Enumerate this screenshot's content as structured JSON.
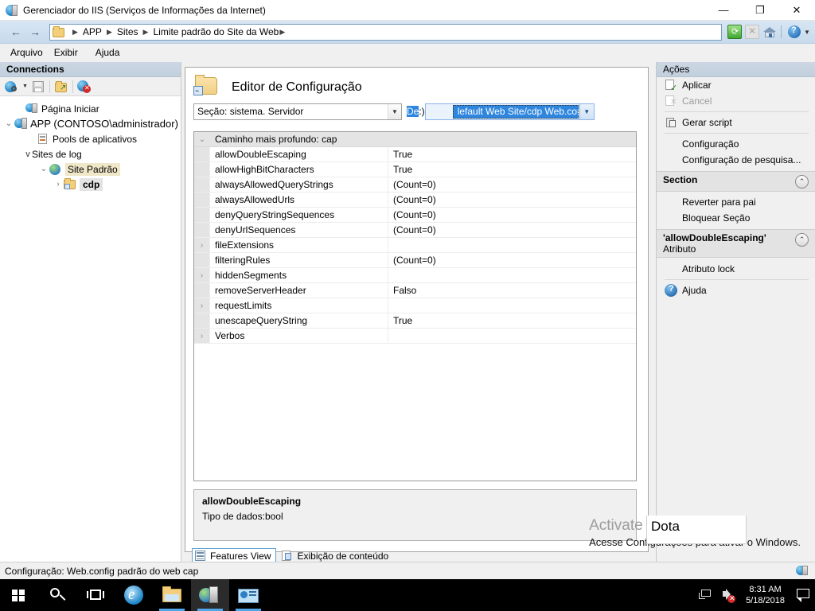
{
  "window": {
    "title": "Gerenciador do IIS (Serviços de Informações da Internet)",
    "icon": "iis-manager-icon",
    "minimize": "—",
    "restore": "❐",
    "close": "✕"
  },
  "address_bar": {
    "back": "←",
    "forward": "→",
    "breadcrumb": [
      "APP",
      "Sites",
      "Limite padrão do Site da Web"
    ],
    "separator": "▶",
    "trailing_arrow": "▶",
    "buttons": [
      "refresh-icon",
      "stop-icon",
      "home-icon",
      "help-icon",
      "help-dropdown-icon"
    ]
  },
  "menu": {
    "items": [
      "Arquivo",
      "Exibir",
      "Ajuda"
    ]
  },
  "connections": {
    "header": "Connections",
    "toolbar": [
      "connect-to-icon",
      "save-connection-icon",
      "open-connection-icon",
      "delete-connection-icon"
    ],
    "tree": [
      {
        "label": "Página Iniciar",
        "indent": 1,
        "chevron": "",
        "icon": "server-page-icon",
        "selected": false
      },
      {
        "label": "APP (CONTOSO\\administrador)",
        "indent": 0,
        "chevron": "⌄",
        "icon": "server-icon",
        "selected": false
      },
      {
        "label": "Pools de aplicativos",
        "indent": 2,
        "chevron": "",
        "icon": "app-pools-icon",
        "selected": false
      },
      {
        "label": "Sites de log",
        "indent": 2,
        "chevron": "v",
        "icon": "",
        "selected": false
      },
      {
        "label": "Site Padrão",
        "indent": 3,
        "chevron": "⌄",
        "icon": "site-globe-icon",
        "selected": false
      },
      {
        "label": "cdp",
        "indent": 4,
        "chevron": "›",
        "icon": "folder-app-icon",
        "selected": true
      }
    ]
  },
  "feature": {
    "icon": "config-editor-icon",
    "title": "Editor de Configuração",
    "section_combo": {
      "value": "Seção: sistema. Servidor",
      "arrow": "▼"
    },
    "from_label_prefix": "De",
    "from_label_suffix": ":)",
    "from_combo": {
      "value": "lefault Web Site/cdp Web.config",
      "arrow": "▼"
    },
    "grid": {
      "header": {
        "gutter": "⌄",
        "label": "Caminho mais profundo: cap"
      },
      "rows": [
        {
          "expander": "",
          "name": "allowDoubleEscaping",
          "value": "True"
        },
        {
          "expander": "",
          "name": "allowHighBitCharacters",
          "value": "True"
        },
        {
          "expander": "",
          "name": "alwaysAllowedQueryStrings",
          "value": "(Count=0)"
        },
        {
          "expander": "",
          "name": "alwaysAllowedUrls",
          "value": "(Count=0)"
        },
        {
          "expander": "",
          "name": "denyQueryStringSequences",
          "value": "(Count=0)"
        },
        {
          "expander": "",
          "name": "denyUrlSequences",
          "value": "(Count=0)"
        },
        {
          "expander": "›",
          "name": "fileExtensions",
          "value": ""
        },
        {
          "expander": "",
          "name": "filteringRules",
          "value": "(Count=0)"
        },
        {
          "expander": "›",
          "name": "hiddenSegments",
          "value": ""
        },
        {
          "expander": "",
          "name": "removeServerHeader",
          "value": "Falso"
        },
        {
          "expander": "›",
          "name": "requestLimits",
          "value": ""
        },
        {
          "expander": "",
          "name": "unescapeQueryString",
          "value": "True"
        },
        {
          "expander": "›",
          "name": "Verbos",
          "value": ""
        }
      ]
    },
    "description": {
      "title": "allowDoubleEscaping",
      "line": "Tipo de dados:bool"
    },
    "view_tabs": [
      {
        "label": "Features View",
        "icon": "features-view-icon",
        "active": true
      },
      {
        "label": "Exibição de conteúdo",
        "icon": "content-view-icon",
        "active": false
      }
    ]
  },
  "actions": {
    "header": "Ações",
    "items": [
      {
        "label": "Aplicar",
        "icon": "apply-icon",
        "type": "item",
        "disabled": false
      },
      {
        "label": "Cancel",
        "icon": "cancel-icon",
        "type": "item",
        "disabled": true
      },
      {
        "type": "separator"
      },
      {
        "label": "Gerar script",
        "icon": "generate-script-icon",
        "type": "item",
        "disabled": false
      },
      {
        "type": "separator"
      },
      {
        "label": "Configuração",
        "icon": "",
        "type": "link",
        "disabled": false
      },
      {
        "label": "Configuração de pesquisa...",
        "icon": "",
        "type": "link",
        "disabled": false
      },
      {
        "type": "group",
        "title": "Section",
        "subtitle": "",
        "collapse": "⌃"
      },
      {
        "label": "Reverter para pai",
        "icon": "",
        "type": "link",
        "disabled": false
      },
      {
        "label": "Bloquear Seção",
        "icon": "",
        "type": "link",
        "disabled": false
      },
      {
        "type": "group",
        "title": "'allowDoubleEscaping'",
        "subtitle": "Atributo",
        "collapse": "⌃"
      },
      {
        "label": "Atributo lock",
        "icon": "",
        "type": "link",
        "disabled": false
      },
      {
        "type": "separator"
      },
      {
        "label": "Ajuda",
        "icon": "help-circle-icon",
        "type": "item",
        "disabled": false
      }
    ]
  },
  "watermark": {
    "line1": "Activate W",
    "overlay": "Dota",
    "line2": "Acesse Configurações para ativar o Windows."
  },
  "status_bar": {
    "text": "Configuração: Web.config padrão do web cap",
    "icon": "iis-status-icon"
  },
  "taskbar": {
    "items": [
      {
        "name": "start-button",
        "icon": "windows-logo-icon",
        "active": false,
        "running": false
      },
      {
        "name": "search-button",
        "icon": "search-icon",
        "active": false,
        "running": false
      },
      {
        "name": "task-view-button",
        "icon": "task-view-icon",
        "active": false,
        "running": false
      },
      {
        "name": "internet-explorer-button",
        "icon": "internet-explorer-icon",
        "active": false,
        "running": false
      },
      {
        "name": "file-explorer-button",
        "icon": "file-explorer-icon",
        "active": false,
        "running": true
      },
      {
        "name": "iis-manager-button",
        "icon": "iis-manager-icon",
        "active": true,
        "running": true
      },
      {
        "name": "server-manager-button",
        "icon": "server-manager-icon",
        "active": false,
        "running": true
      }
    ],
    "tray": {
      "network_icon": "network-icon",
      "volume_icon": "volume-muted-icon",
      "time": "8:31 AM",
      "date": "5/18/2018",
      "action_center_icon": "action-center-icon"
    }
  },
  "colors": {
    "accent": "#2f86de",
    "pane_header": "#c8d4e0",
    "taskbar": "#000000",
    "selection": "#2f86de"
  }
}
